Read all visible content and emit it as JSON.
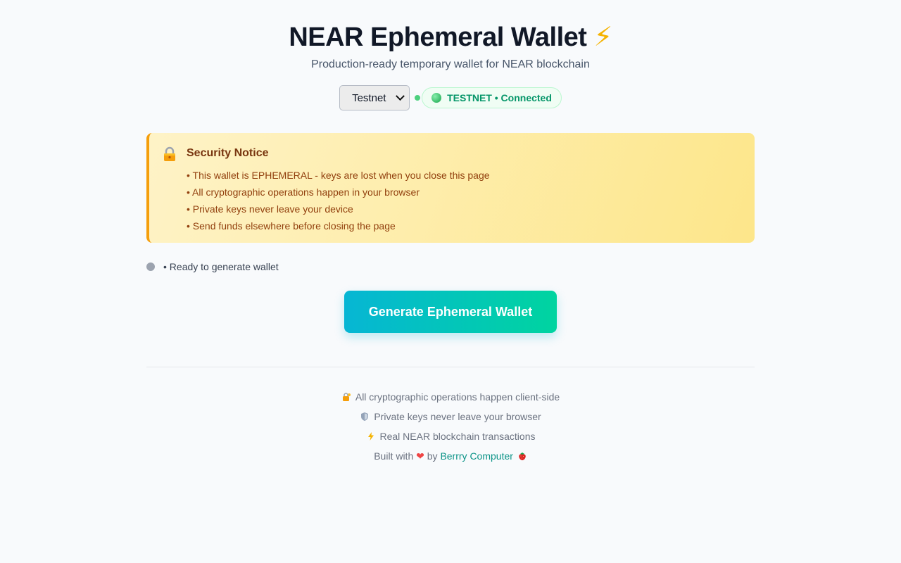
{
  "header": {
    "title": "NEAR Ephemeral Wallet",
    "title_emoji": "⚡",
    "subtitle": "Production-ready temporary wallet for NEAR blockchain"
  },
  "network": {
    "selected": "Testnet",
    "status_text": "TESTNET • Connected",
    "status_color": "#059669"
  },
  "security_notice": {
    "icon": "lock-icon",
    "title": "Security Notice",
    "items": [
      "• This wallet is EPHEMERAL - keys are lost when you close this page",
      "• All cryptographic operations happen in your browser",
      "• Private keys never leave your device",
      "• Send funds elsewhere before closing the page"
    ]
  },
  "status": {
    "text": "• Ready to generate wallet"
  },
  "actions": {
    "generate_label": "Generate Ephemeral Wallet"
  },
  "footer": {
    "line1": "All cryptographic operations happen client-side",
    "line2": "Private keys never leave your browser",
    "line3": "Real NEAR blockchain transactions",
    "built_prefix": "Built with",
    "built_by": "by",
    "link_text": "Berrry Computer"
  },
  "colors": {
    "accent_start": "#06b6d4",
    "accent_end": "#00d4a0",
    "notice_border": "#f59e0b"
  }
}
